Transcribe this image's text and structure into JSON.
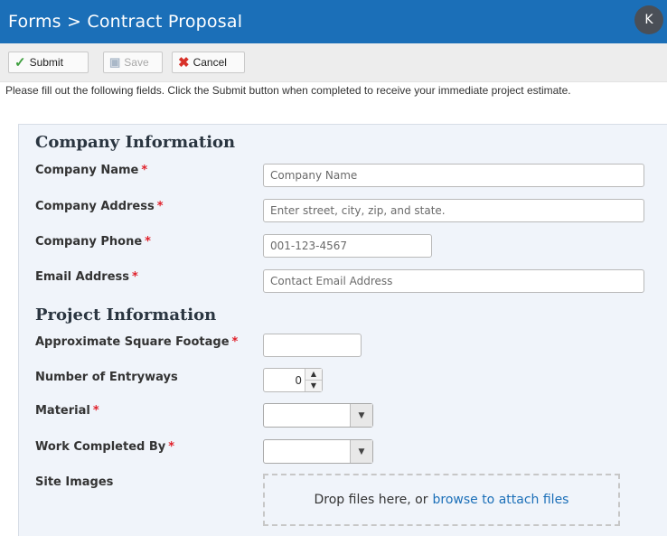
{
  "header": {
    "title": "Forms > Contract Proposal",
    "avatar_initial": "K"
  },
  "toolbar": {
    "submit_label": "Submit",
    "save_label": "Save",
    "cancel_label": "Cancel"
  },
  "instructions": "Please fill out the following fields. Click the Submit button when completed to receive your immediate project estimate.",
  "sections": {
    "company_title": "Company Information",
    "project_title": "Project Information"
  },
  "fields": {
    "company_name": {
      "label": "Company Name",
      "required": "*",
      "placeholder": "Company Name",
      "value": ""
    },
    "company_address": {
      "label": "Company Address",
      "required": "*",
      "placeholder": "Enter street, city, zip, and state.",
      "value": ""
    },
    "company_phone": {
      "label": "Company Phone",
      "required": "*",
      "placeholder": "001-123-4567",
      "value": ""
    },
    "email_address": {
      "label": "Email Address",
      "required": "*",
      "placeholder": "Contact Email Address",
      "value": ""
    },
    "square_footage": {
      "label": "Approximate Square Footage",
      "required": "*",
      "value": ""
    },
    "entryways": {
      "label": "Number of Entryways",
      "value": "0"
    },
    "material": {
      "label": "Material",
      "required": "*",
      "selected": ""
    },
    "work_completed_by": {
      "label": "Work Completed By",
      "required": "*",
      "selected": ""
    },
    "site_images": {
      "label": "Site Images",
      "drop_text": "Drop files here, or",
      "browse_link": "browse to attach files"
    }
  },
  "colors": {
    "header_bg": "#1b6fb8",
    "required": "#e0202a",
    "panel_bg": "#f0f4fa",
    "link": "#1b6fb8"
  },
  "icons": {
    "submit": "check-icon",
    "save": "save-icon",
    "cancel": "x-icon"
  }
}
